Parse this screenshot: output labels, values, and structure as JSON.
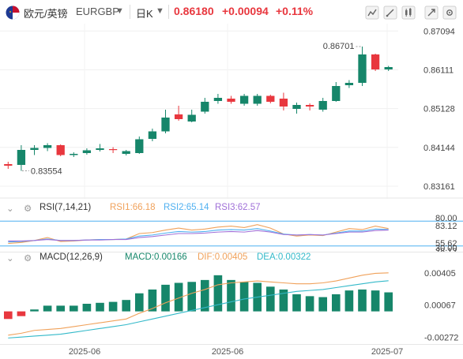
{
  "header": {
    "symbol_name": "欧元/英镑",
    "symbol_code": "EURGBP",
    "period": "日K",
    "price": "0.86180",
    "change": "+0.00094",
    "change_pct": "+0.11%",
    "up_color": "#e8373e",
    "down_color": "#16866a",
    "tools": [
      "indicator-icon",
      "draw-icon",
      "chart-type-icon",
      "fullscreen-icon",
      "settings-icon"
    ]
  },
  "chart_data": [
    {
      "type": "candlestick",
      "title": "欧元/英镑 EURGBP 日K",
      "y_ticks": [
        "0.87094",
        "0.86111",
        "0.85128",
        "0.84144",
        "0.83161"
      ],
      "ylim": [
        0.83,
        0.872
      ],
      "x_ticks": [
        "2025-06",
        "2025-06",
        "2025-07"
      ],
      "annotations": {
        "high": "0.86701",
        "low": "0.83554"
      },
      "candles": [
        {
          "o": 0.8372,
          "h": 0.8378,
          "l": 0.836,
          "c": 0.8368
        },
        {
          "o": 0.837,
          "h": 0.842,
          "l": 0.8355,
          "c": 0.8408
        },
        {
          "o": 0.8408,
          "h": 0.842,
          "l": 0.8395,
          "c": 0.8413
        },
        {
          "o": 0.8413,
          "h": 0.8425,
          "l": 0.8405,
          "c": 0.842
        },
        {
          "o": 0.842,
          "h": 0.8422,
          "l": 0.8392,
          "c": 0.8395
        },
        {
          "o": 0.8395,
          "h": 0.8402,
          "l": 0.839,
          "c": 0.8398
        },
        {
          "o": 0.84,
          "h": 0.8412,
          "l": 0.8396,
          "c": 0.8407
        },
        {
          "o": 0.8408,
          "h": 0.8423,
          "l": 0.8404,
          "c": 0.8412
        },
        {
          "o": 0.841,
          "h": 0.8415,
          "l": 0.84,
          "c": 0.8408
        },
        {
          "o": 0.8398,
          "h": 0.8408,
          "l": 0.8394,
          "c": 0.8405
        },
        {
          "o": 0.84,
          "h": 0.8442,
          "l": 0.8398,
          "c": 0.8435
        },
        {
          "o": 0.8436,
          "h": 0.8462,
          "l": 0.843,
          "c": 0.8455
        },
        {
          "o": 0.8455,
          "h": 0.851,
          "l": 0.845,
          "c": 0.849
        },
        {
          "o": 0.8498,
          "h": 0.852,
          "l": 0.8482,
          "c": 0.8486
        },
        {
          "o": 0.848,
          "h": 0.851,
          "l": 0.8478,
          "c": 0.8497
        },
        {
          "o": 0.8505,
          "h": 0.854,
          "l": 0.85,
          "c": 0.853
        },
        {
          "o": 0.8532,
          "h": 0.855,
          "l": 0.8525,
          "c": 0.854
        },
        {
          "o": 0.8538,
          "h": 0.8545,
          "l": 0.8525,
          "c": 0.853
        },
        {
          "o": 0.8525,
          "h": 0.855,
          "l": 0.852,
          "c": 0.8545
        },
        {
          "o": 0.8525,
          "h": 0.855,
          "l": 0.852,
          "c": 0.8545
        },
        {
          "o": 0.8545,
          "h": 0.8548,
          "l": 0.8526,
          "c": 0.853
        },
        {
          "o": 0.8538,
          "h": 0.8553,
          "l": 0.8508,
          "c": 0.8518
        },
        {
          "o": 0.8512,
          "h": 0.8528,
          "l": 0.85,
          "c": 0.8522
        },
        {
          "o": 0.8522,
          "h": 0.8526,
          "l": 0.8508,
          "c": 0.8518
        },
        {
          "o": 0.851,
          "h": 0.854,
          "l": 0.8505,
          "c": 0.8532
        },
        {
          "o": 0.8532,
          "h": 0.858,
          "l": 0.853,
          "c": 0.857
        },
        {
          "o": 0.8572,
          "h": 0.8585,
          "l": 0.8565,
          "c": 0.8578
        },
        {
          "o": 0.8578,
          "h": 0.867,
          "l": 0.857,
          "c": 0.865
        },
        {
          "o": 0.865,
          "h": 0.8652,
          "l": 0.8608,
          "c": 0.8612
        },
        {
          "o": 0.8612,
          "h": 0.8621,
          "l": 0.8608,
          "c": 0.8618
        }
      ]
    },
    {
      "type": "line",
      "title": "RSI(7,14,21)",
      "series": [
        {
          "name": "RSI1:66.18",
          "color": "#f0a15a",
          "values": [
            35,
            37,
            41,
            47,
            39,
            40,
            42,
            43,
            43,
            44,
            55,
            57,
            62,
            66,
            62,
            64,
            68,
            70,
            67,
            73,
            66,
            54,
            50,
            52,
            51,
            58,
            65,
            63,
            70,
            65
          ]
        },
        {
          "name": "RSI2:65.14",
          "color": "#4fb0f0",
          "values": [
            38,
            39,
            41,
            44,
            41,
            41,
            42,
            43,
            43,
            44,
            50,
            52,
            56,
            59,
            58,
            59,
            62,
            63,
            62,
            65,
            60,
            54,
            52,
            53,
            52,
            56,
            60,
            60,
            64,
            63
          ]
        },
        {
          "name": "RSI3:62.57",
          "color": "#a070d8",
          "values": [
            40,
            40,
            41,
            43,
            41,
            41,
            42,
            42,
            43,
            43,
            47,
            49,
            52,
            55,
            55,
            56,
            58,
            59,
            58,
            61,
            58,
            53,
            52,
            53,
            52,
            55,
            58,
            58,
            61,
            62
          ]
        }
      ],
      "y_ticks": [
        "80.00",
        "83.12",
        "55.62",
        "30.00",
        "28.12"
      ],
      "levels": [
        80,
        30
      ],
      "ylim": [
        20,
        90
      ]
    },
    {
      "type": "bar",
      "title": "MACD(12,26,9)",
      "series": [
        {
          "name": "MACD:0.00166",
          "color": "#16866a",
          "values": [
            -0.0008,
            -0.0005,
            0.0002,
            0.0006,
            0.0006,
            0.0006,
            0.0008,
            0.0009,
            0.001,
            0.0012,
            0.0019,
            0.0023,
            0.0028,
            0.003,
            0.0031,
            0.0033,
            0.0038,
            0.0033,
            0.0031,
            0.003,
            0.0026,
            0.0023,
            0.0018,
            0.0016,
            0.0015,
            0.0018,
            0.0022,
            0.0023,
            0.0022,
            0.002
          ]
        },
        {
          "name": "DIF:0.00405",
          "color": "#f0a15a",
          "values": [
            -0.0025,
            -0.0023,
            -0.002,
            -0.0019,
            -0.0018,
            -0.0016,
            -0.0014,
            -0.0012,
            -0.001,
            -0.0008,
            -0.0002,
            0.0003,
            0.0009,
            0.0014,
            0.0019,
            0.0023,
            0.0028,
            0.003,
            0.0031,
            0.0032,
            0.0031,
            0.003,
            0.0029,
            0.0029,
            0.003,
            0.0032,
            0.0035,
            0.0038,
            0.004,
            0.00405
          ]
        },
        {
          "name": "DEA:0.00322",
          "color": "#33b9c9",
          "values": [
            -0.0028,
            -0.0027,
            -0.0026,
            -0.0025,
            -0.0024,
            -0.0022,
            -0.002,
            -0.0018,
            -0.0016,
            -0.0014,
            -0.0011,
            -0.0008,
            -0.0005,
            -0.0002,
            0.0001,
            0.0004,
            0.0007,
            0.001,
            0.0013,
            0.0015,
            0.0017,
            0.0019,
            0.0021,
            0.0022,
            0.0023,
            0.0025,
            0.0027,
            0.0029,
            0.0031,
            0.00322
          ]
        }
      ],
      "y_ticks": [
        "0.00405",
        "0.00067",
        "-0.00272"
      ],
      "ylim": [
        -0.0031,
        0.0047
      ]
    }
  ]
}
